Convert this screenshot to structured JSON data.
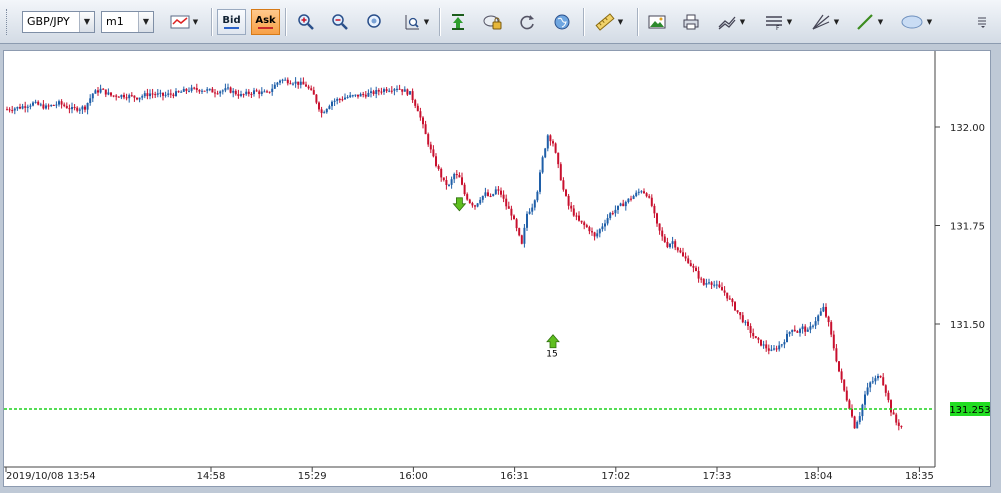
{
  "toolbar": {
    "symbol": "GBP/JPY",
    "timeframe": "m1",
    "bid_label": "Bid",
    "ask_label": "Ask"
  },
  "colors": {
    "up": "#1f5fa8",
    "down": "#c8102e",
    "price_line": "#1bd21b",
    "price_tag_bg": "#22dd22"
  },
  "chart_data": {
    "type": "candlestick",
    "symbol": "GBP/JPY",
    "timeframe": "m1",
    "x_tick_labels": [
      "2019/10/08 13:54",
      "14:58",
      "15:29",
      "16:00",
      "16:31",
      "17:02",
      "17:33",
      "18:04",
      "18:35"
    ],
    "y_tick_labels": [
      "131.50",
      "131.75",
      "132.00"
    ],
    "ylim": [
      131.1,
      132.22
    ],
    "current_price": 131.253,
    "current_price_label": "131.253",
    "grid": false,
    "markers": [
      {
        "kind": "sell-arrow",
        "time_index": 174,
        "price": 131.8
      },
      {
        "kind": "buy-arrow",
        "time_index": 210,
        "price": 131.455,
        "label": "15"
      }
    ],
    "close_path": [
      [
        0,
        132.045
      ],
      [
        5,
        132.05
      ],
      [
        10,
        132.06
      ],
      [
        15,
        132.05
      ],
      [
        20,
        132.06
      ],
      [
        25,
        132.045
      ],
      [
        30,
        132.05
      ],
      [
        33,
        132.085
      ],
      [
        36,
        132.095
      ],
      [
        40,
        132.08
      ],
      [
        45,
        132.08
      ],
      [
        50,
        132.075
      ],
      [
        55,
        132.085
      ],
      [
        60,
        132.08
      ],
      [
        65,
        132.085
      ],
      [
        70,
        132.095
      ],
      [
        75,
        132.095
      ],
      [
        80,
        132.09
      ],
      [
        85,
        132.095
      ],
      [
        90,
        132.08
      ],
      [
        95,
        132.09
      ],
      [
        100,
        132.085
      ],
      [
        105,
        132.12
      ],
      [
        110,
        132.115
      ],
      [
        115,
        132.105
      ],
      [
        118,
        132.08
      ],
      [
        121,
        132.035
      ],
      [
        125,
        132.065
      ],
      [
        130,
        132.075
      ],
      [
        135,
        132.08
      ],
      [
        140,
        132.085
      ],
      [
        145,
        132.095
      ],
      [
        150,
        132.1
      ],
      [
        155,
        132.085
      ],
      [
        158,
        132.045
      ],
      [
        161,
        131.98
      ],
      [
        164,
        131.92
      ],
      [
        166,
        131.89
      ],
      [
        168,
        131.86
      ],
      [
        170,
        131.85
      ],
      [
        172,
        131.88
      ],
      [
        174,
        131.87
      ],
      [
        176,
        131.83
      ],
      [
        178,
        131.81
      ],
      [
        180,
        131.8
      ],
      [
        182,
        131.82
      ],
      [
        184,
        131.83
      ],
      [
        186,
        131.82
      ],
      [
        188,
        131.84
      ],
      [
        190,
        131.83
      ],
      [
        192,
        131.8
      ],
      [
        194,
        131.78
      ],
      [
        196,
        131.74
      ],
      [
        198,
        131.7
      ],
      [
        200,
        131.78
      ],
      [
        202,
        131.8
      ],
      [
        204,
        131.84
      ],
      [
        206,
        131.92
      ],
      [
        208,
        131.98
      ],
      [
        210,
        131.96
      ],
      [
        212,
        131.9
      ],
      [
        214,
        131.84
      ],
      [
        216,
        131.8
      ],
      [
        218,
        131.78
      ],
      [
        220,
        131.76
      ],
      [
        222,
        131.75
      ],
      [
        224,
        131.74
      ],
      [
        226,
        131.72
      ],
      [
        228,
        131.74
      ],
      [
        230,
        131.76
      ],
      [
        232,
        131.78
      ],
      [
        234,
        131.79
      ],
      [
        236,
        131.8
      ],
      [
        238,
        131.81
      ],
      [
        240,
        131.82
      ],
      [
        242,
        131.83
      ],
      [
        244,
        131.84
      ],
      [
        246,
        131.83
      ],
      [
        248,
        131.8
      ],
      [
        250,
        131.75
      ],
      [
        252,
        131.72
      ],
      [
        254,
        131.7
      ],
      [
        256,
        131.71
      ],
      [
        258,
        131.69
      ],
      [
        260,
        131.67
      ],
      [
        262,
        131.66
      ],
      [
        264,
        131.64
      ],
      [
        266,
        131.62
      ],
      [
        268,
        131.6
      ],
      [
        270,
        131.61
      ],
      [
        272,
        131.6
      ],
      [
        274,
        131.59
      ],
      [
        276,
        131.58
      ],
      [
        278,
        131.56
      ],
      [
        280,
        131.54
      ],
      [
        282,
        131.52
      ],
      [
        284,
        131.5
      ],
      [
        286,
        131.48
      ],
      [
        288,
        131.46
      ],
      [
        290,
        131.45
      ],
      [
        292,
        131.44
      ],
      [
        294,
        131.43
      ],
      [
        296,
        131.44
      ],
      [
        298,
        131.45
      ],
      [
        300,
        131.47
      ],
      [
        302,
        131.49
      ],
      [
        304,
        131.48
      ],
      [
        306,
        131.49
      ],
      [
        308,
        131.48
      ],
      [
        310,
        131.5
      ],
      [
        312,
        131.52
      ],
      [
        314,
        131.54
      ],
      [
        316,
        131.5
      ],
      [
        318,
        131.44
      ],
      [
        320,
        131.38
      ],
      [
        322,
        131.33
      ],
      [
        324,
        131.29
      ],
      [
        326,
        131.24
      ],
      [
        328,
        131.27
      ],
      [
        330,
        131.32
      ],
      [
        332,
        131.35
      ],
      [
        334,
        131.36
      ],
      [
        336,
        131.37
      ],
      [
        338,
        131.33
      ],
      [
        340,
        131.28
      ],
      [
        342,
        131.25
      ],
      [
        344,
        131.24
      ]
    ]
  }
}
